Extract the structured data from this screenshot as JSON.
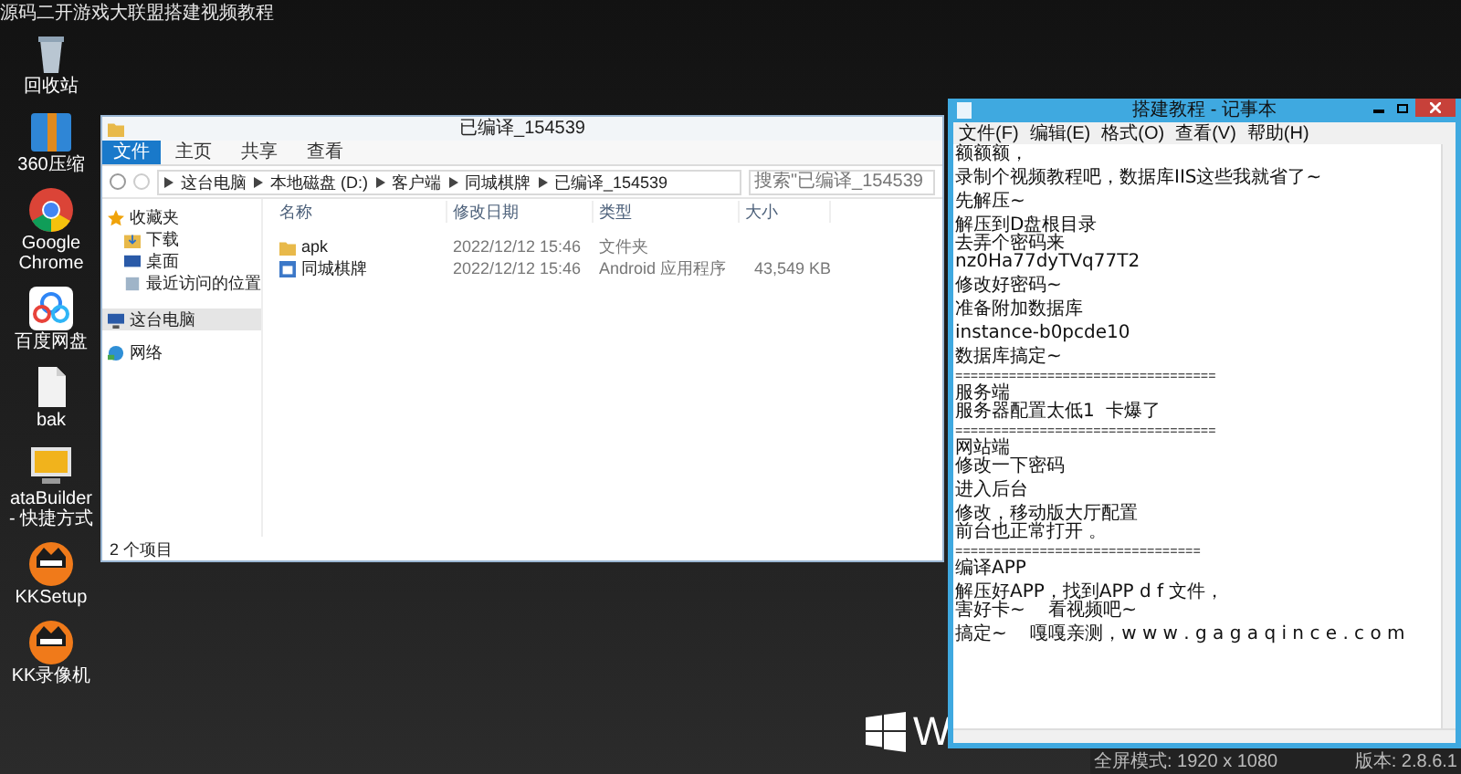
{
  "desktop": {
    "caption": "源码二开游戏大联盟搭建视频教程",
    "icons": [
      {
        "kind": "bin",
        "lines": [
          "回收站"
        ]
      },
      {
        "kind": "archive",
        "lines": [
          "360压缩"
        ]
      },
      {
        "kind": "chrome",
        "lines": [
          "Google",
          "Chrome"
        ]
      },
      {
        "kind": "cloud",
        "lines": [
          "百度网盘"
        ]
      },
      {
        "kind": "file",
        "lines": [
          "bak"
        ]
      },
      {
        "kind": "monitor",
        "lines": [
          "ataBuilder",
          "- 快捷方式"
        ]
      },
      {
        "kind": "kk",
        "lines": [
          "KKSetup"
        ]
      },
      {
        "kind": "kk",
        "lines": [
          "KK录像机"
        ]
      }
    ],
    "wallpaper_text": "W"
  },
  "explorer": {
    "title": "已编译_154539",
    "tabs": [
      {
        "label": "文件",
        "selected": true
      },
      {
        "label": "主页",
        "selected": false
      },
      {
        "label": "共享",
        "selected": false
      },
      {
        "label": "查看",
        "selected": false
      }
    ],
    "path": [
      "这台电脑",
      "本地磁盘 (D:)",
      "客户端",
      "同城棋牌",
      "已编译_154539"
    ],
    "search": {
      "placeholder": "搜索\"已编译_154539"
    },
    "nav": [
      {
        "kind": "star",
        "label": "收藏夹",
        "selected": false
      },
      {
        "kind": "download",
        "label": "下载",
        "selected": false,
        "indent": true
      },
      {
        "kind": "desktop",
        "label": "桌面",
        "selected": false,
        "indent": true
      },
      {
        "kind": "recent",
        "label": "最近访问的位置",
        "selected": false,
        "indent": true
      },
      {
        "kind": "pc",
        "label": "这台电脑",
        "selected": true
      },
      {
        "kind": "network",
        "label": "网络",
        "selected": false
      }
    ],
    "columns": [
      "名称",
      "修改日期",
      "类型",
      "大小"
    ],
    "rows": [
      {
        "kind": "folder",
        "name": "apk",
        "date": "2022/12/12 15:46",
        "type": "文件夹"
      },
      {
        "kind": "app",
        "name": "同城棋牌",
        "date": "2022/12/12 15:46",
        "type": "Android 应用程序",
        "size": "43,549 KB"
      }
    ],
    "status": "2 个项目"
  },
  "notepad": {
    "title": "搭建教程 - 记事本",
    "menu": [
      "文件(F)",
      "编辑(E)",
      "格式(O)",
      "查看(V)",
      "帮助(H)"
    ],
    "paragraphs": [
      [
        {
          "kind": "text",
          "text": "额额额，"
        }
      ],
      [
        {
          "kind": "text",
          "text": "录制个视频教程吧，数据库IIS这些我就省了~"
        }
      ],
      [
        {
          "kind": "text",
          "text": "先解压~"
        }
      ],
      [
        {
          "kind": "text",
          "text": "解压到D盘根目录"
        },
        {
          "kind": "text",
          "text": "去弄个密码来"
        },
        {
          "kind": "text",
          "text": "nz0Ha77dyTVq77T2"
        }
      ],
      [
        {
          "kind": "text",
          "text": "修改好密码~"
        }
      ],
      [
        {
          "kind": "text",
          "text": "准备附加数据库"
        }
      ],
      [
        {
          "kind": "text",
          "text": "instance-b0pcde10"
        }
      ],
      [
        {
          "kind": "text",
          "text": "数据库搞定~"
        }
      ],
      [
        {
          "kind": "rule",
          "text": "=================================="
        },
        {
          "kind": "text",
          "text": "服务端"
        },
        {
          "kind": "text",
          "text": "服务器配置太低1  卡爆了"
        }
      ],
      [
        {
          "kind": "rule",
          "text": "=================================="
        },
        {
          "kind": "text",
          "text": "网站端"
        },
        {
          "kind": "text",
          "text": "修改一下密码"
        }
      ],
      [
        {
          "kind": "text",
          "text": "进入后台"
        }
      ],
      [
        {
          "kind": "text",
          "text": "修改，移动版大厅配置"
        },
        {
          "kind": "text",
          "text": "前台也正常打开 。"
        }
      ],
      [
        {
          "kind": "rule",
          "text": "================================"
        },
        {
          "kind": "text",
          "text": "编译APP"
        }
      ],
      [
        {
          "kind": "text",
          "text": "解压好APP，找到APP d f 文件，"
        },
        {
          "kind": "text",
          "text": "害好卡~    看视频吧~"
        }
      ],
      [
        {
          "kind": "text",
          "text": "搞定~    嘎嘎亲测，w w w . g a g a q i n c e . c o m"
        }
      ]
    ]
  },
  "recorder_bar": {
    "mode": "全屏模式: 1920 x 1080",
    "version": "版本: 2.8.6.1"
  }
}
